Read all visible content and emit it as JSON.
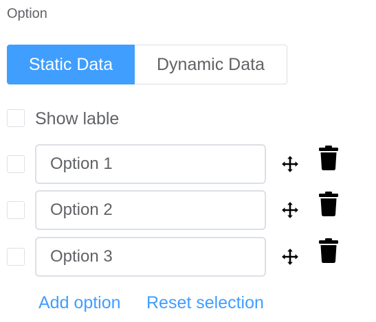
{
  "section": {
    "title": "Option"
  },
  "tabs": [
    {
      "label": "Static Data",
      "active": true
    },
    {
      "label": "Dynamic Data",
      "active": false
    }
  ],
  "show_label": {
    "text": "Show lable",
    "checked": false
  },
  "options": [
    {
      "value": "Option 1",
      "checked": false
    },
    {
      "value": "Option 2",
      "checked": false
    },
    {
      "value": "Option 3",
      "checked": false
    }
  ],
  "actions": {
    "add_option": "Add option",
    "reset_selection": "Reset selection"
  },
  "colors": {
    "accent": "#409eff",
    "text": "#606266",
    "border": "#dcdfe6"
  },
  "icons": {
    "move": "move-arrows-icon",
    "delete": "trash-icon"
  }
}
